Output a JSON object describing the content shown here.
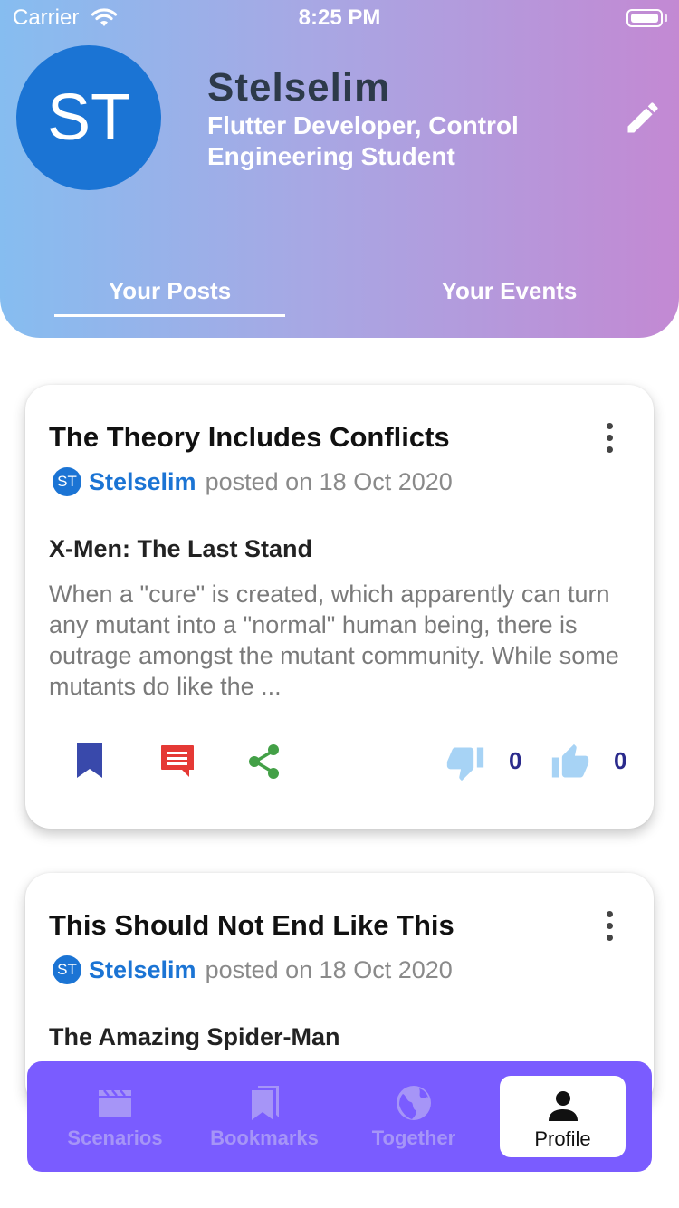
{
  "status_bar": {
    "carrier": "Carrier",
    "time": "8:25 PM"
  },
  "profile": {
    "avatar_initials": "ST",
    "name": "Stelselim",
    "bio": "Flutter Developer, Control Engineering Student"
  },
  "tabs": [
    {
      "label": "Your Posts",
      "selected": true
    },
    {
      "label": "Your Events",
      "selected": false
    }
  ],
  "posts": [
    {
      "title": "The Theory Includes Conflicts",
      "author_initials": "ST",
      "author": "Stelselim",
      "posted_text": "posted on 18 Oct 2020",
      "movie": "X-Men: The Last Stand",
      "description": "When a \"cure\" is created, which apparently can turn any mutant into a \"normal\" human being, there is outrage amongst the mutant community. While some mutants do like the ...",
      "dislikes": "0",
      "likes": "0"
    },
    {
      "title": "This Should Not End Like This",
      "author_initials": "ST",
      "author": "Stelselim",
      "posted_text": "posted on 18 Oct 2020",
      "movie": "The Amazing Spider-Man"
    }
  ],
  "nav": [
    {
      "label": "Scenarios",
      "icon": "clapperboard-icon"
    },
    {
      "label": "Bookmarks",
      "icon": "bookmarks-icon"
    },
    {
      "label": "Together",
      "icon": "globe-icon"
    },
    {
      "label": "Profile",
      "icon": "person-icon",
      "active": true
    }
  ],
  "colors": {
    "header_gradient_start": "#86bdf0",
    "header_gradient_end": "#c389d3",
    "avatar": "#1b74d4",
    "bookmark": "#3949ab",
    "comment": "#e53935",
    "share": "#43a047",
    "like": "#a7d3f5",
    "nav_background": "#7a5cff"
  }
}
